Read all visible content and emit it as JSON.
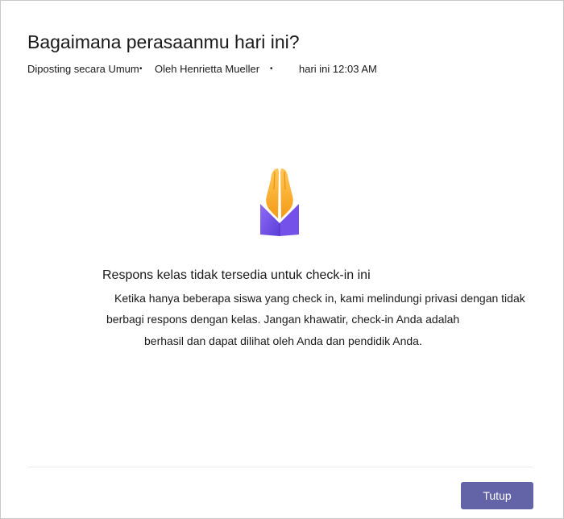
{
  "dialog": {
    "title": "Bagaimana perasaanmu hari ini?",
    "meta": {
      "posted": "Diposting secara Umum",
      "separator": "•",
      "author": "Oleh Henrietta Mueller",
      "time": "hari ini 12:03 AM"
    },
    "emoji_icon": "folded-hands-icon",
    "heading": "Respons kelas tidak tersedia untuk check-in ini",
    "body_lines": [
      "Ketika hanya beberapa siswa yang check in, kami melindungi privasi dengan tidak",
      "berbagi respons dengan kelas. Jangan khawatir, check-in Anda adalah",
      "berhasil dan dapat dilihat oleh Anda dan pendidik Anda."
    ],
    "close_label": "Tutup",
    "colors": {
      "primary_button": "#6264a7",
      "sleeve": "#7b5cf0",
      "hands": "#ffb02e"
    }
  }
}
